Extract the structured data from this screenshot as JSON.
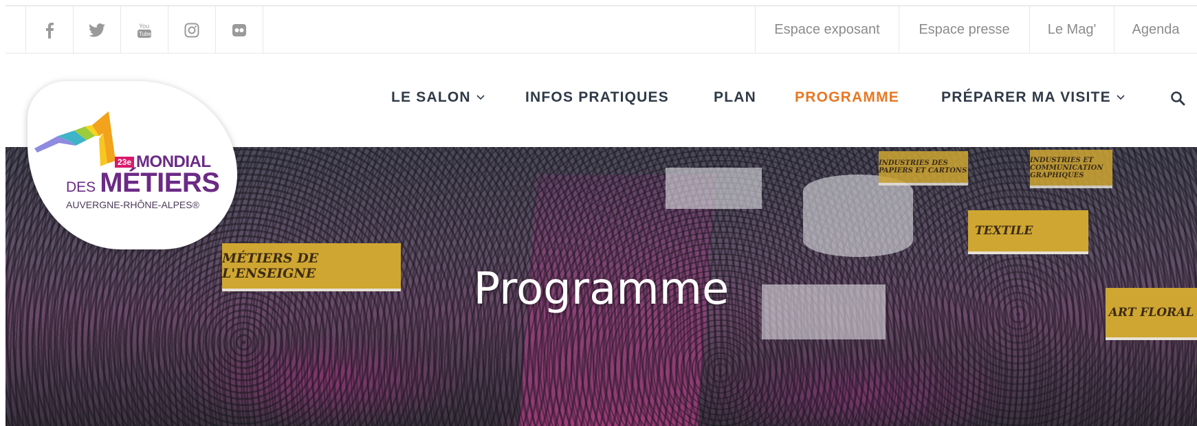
{
  "social": {
    "items": [
      {
        "icon": "facebook-icon"
      },
      {
        "icon": "twitter-icon"
      },
      {
        "icon": "youtube-icon"
      },
      {
        "icon": "instagram-icon"
      },
      {
        "icon": "flickr-icon"
      }
    ]
  },
  "toplinks": [
    "Espace exposant",
    "Espace presse",
    "Le Mag'",
    "Agenda"
  ],
  "nav": {
    "salon": "LE SALON",
    "infos": "INFOS PRATIQUES",
    "plan": "PLAN",
    "programme": "PROGRAMME",
    "preparer": "PRÉPARER MA VISITE"
  },
  "colors": {
    "accent": "#e87722",
    "nav_text": "#2f3a47",
    "brand_purple": "#6b2a86",
    "brand_pink": "#d81a6b"
  },
  "logo": {
    "edition": "23e",
    "mondial": "MONDIAL",
    "des": "DES",
    "metiers": "MÉTIERS",
    "region": "AUVERGNE-RHÔNE-ALPES®"
  },
  "hero": {
    "title": "Programme",
    "signs": [
      "MÉTIERS DE L'ENSEIGNE",
      "TEXTILE",
      "ART FLORAL",
      "INDUSTRIES DES PAPIERS ET CARTONS",
      "INDUSTRIES ET COMMUNICATION GRAPHIQUES"
    ]
  }
}
